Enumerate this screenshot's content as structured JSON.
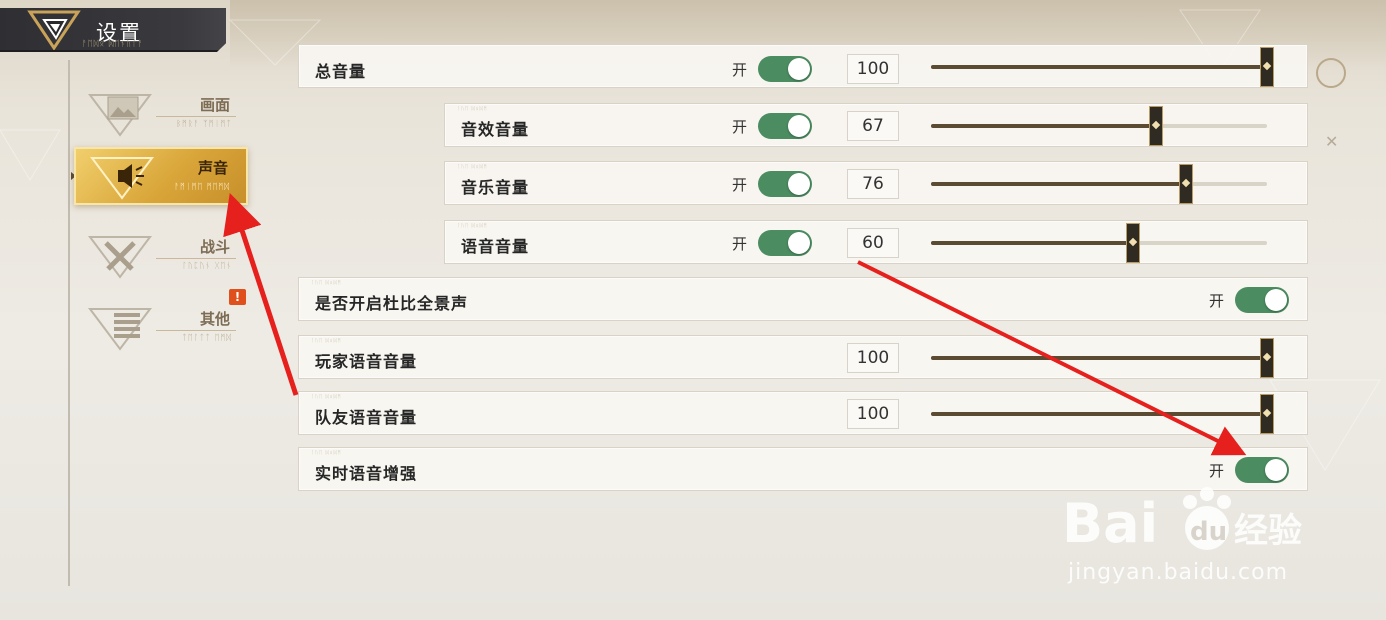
{
  "header": {
    "title": "设置",
    "subtitle": "ᚨᛖᛞᛟ ᛞᛖᚾᚢᛚᚨ"
  },
  "sidebar": {
    "items": [
      {
        "label": "画面",
        "sub": "ᛒᛗᚱᚨ ᛉᛗᛁᛗᛏ",
        "icon": "picture-icon",
        "active": false
      },
      {
        "label": "声音",
        "sub": "ᚨᛗᛁᛗᛖ ᛗᛖᛗᛞ",
        "icon": "speaker-icon",
        "active": true
      },
      {
        "label": "战斗",
        "sub": "ᛚᚢᛈᚢᚾ ᚷᛖᚾ",
        "icon": "crossed-swords-icon",
        "active": false
      },
      {
        "label": "其他",
        "sub": "ᛏᛖᛚᛏᛏ ᛖᛗᛞ",
        "icon": "list-icon",
        "active": false,
        "badge": "!"
      }
    ]
  },
  "settings": {
    "rows": [
      {
        "id": "master",
        "label": "总音量",
        "toggle_text": "开",
        "toggle_on": true,
        "value": "100",
        "level": 1.0
      },
      {
        "id": "sfx",
        "label": "音效音量",
        "toggle_text": "开",
        "toggle_on": true,
        "value": "67",
        "level": 0.67
      },
      {
        "id": "music",
        "label": "音乐音量",
        "toggle_text": "开",
        "toggle_on": true,
        "value": "76",
        "level": 0.76
      },
      {
        "id": "voice",
        "label": "语音音量",
        "toggle_text": "开",
        "toggle_on": true,
        "value": "60",
        "level": 0.6
      },
      {
        "id": "dolby",
        "label": "是否开启杜比全景声",
        "toggle_text": "开",
        "toggle_on": true
      },
      {
        "id": "player_voice",
        "label": "玩家语音音量",
        "value": "100",
        "level": 1.0
      },
      {
        "id": "team_voice",
        "label": "队友语音音量",
        "value": "100",
        "level": 1.0
      },
      {
        "id": "realtime_voice",
        "label": "实时语音增强",
        "toggle_text": "开",
        "toggle_on": true
      }
    ]
  },
  "watermark": {
    "text": "jingyan.baidu.com",
    "brand": "Bai du 经验"
  },
  "colors": {
    "toggle_on": "#4b8c61",
    "accent_gold": "#d9a63a",
    "annotation_red": "#e5201d"
  }
}
